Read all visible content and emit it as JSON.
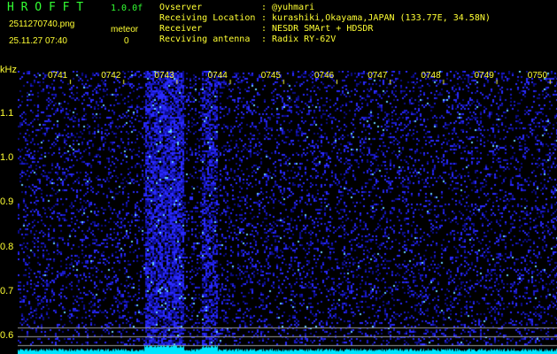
{
  "header": {
    "app_name": "H R O F F T",
    "version": "1.0.0f",
    "filename": "2511270740.png",
    "datetime": "25.11.27 07:40",
    "meteor_label": "meteor",
    "meteor_count": "0",
    "info": [
      {
        "label": "Ovserver",
        "value": ": @yuhmari"
      },
      {
        "label": "Receiving Location",
        "value": ": kurashiki,Okayama,JAPAN (133.77E, 34.58N)"
      },
      {
        "label": "Receiver",
        "value": ": NESDR SMArt + HDSDR"
      },
      {
        "label": "Recviving antenna",
        "value": ": Radix RY-62V"
      }
    ]
  },
  "axis": {
    "y_unit": "kHz",
    "y_ticks": [
      "1.1",
      "1.0",
      "0.9",
      "0.8",
      "0.7",
      "0.6"
    ],
    "x_ticks": [
      "0741",
      "0742",
      "0743",
      "0744",
      "0745",
      "0746",
      "0747",
      "0748",
      "0749",
      "0750"
    ]
  },
  "colors": {
    "text": "#ffff33",
    "title": "#33ff33",
    "signal": "#2222ff",
    "spectrum": "#00e5ff"
  }
}
